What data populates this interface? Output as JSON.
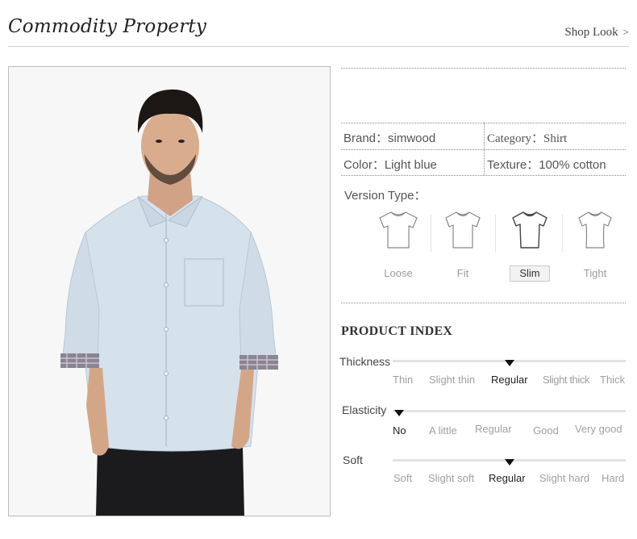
{
  "header": {
    "title": "Commodity Property",
    "shop_look_label": "Shop Look",
    "shop_look_chevron": ">"
  },
  "attributes": {
    "brand": "Brand：simwood",
    "category": "Category：Shirt",
    "color": "Color：Light blue",
    "texture": "Texture：100% cotton"
  },
  "version_type": {
    "label": "Version Type：",
    "options": [
      "Loose",
      "Fit",
      "Slim",
      "Tight"
    ],
    "selected": "Slim"
  },
  "product_index": {
    "title": "PRODUCT INDEX",
    "rows": [
      {
        "label": "Thickness",
        "options": [
          "Thin",
          "Slight thin",
          "Regular",
          "Slight thick",
          "Thick"
        ],
        "selected": "Regular",
        "level": 0.5
      },
      {
        "label": "Elasticity",
        "options": [
          "No",
          "A little",
          "Regular",
          "Good",
          "Very good"
        ],
        "selected": "No",
        "level": 0.0
      },
      {
        "label": "Soft",
        "options": [
          "Soft",
          "Slight soft",
          "Regular",
          "Slight hard",
          "Hard"
        ],
        "selected": "Regular",
        "level": 0.5
      }
    ]
  },
  "colors": {
    "shirt": "#d5e2ec",
    "marker": "#111111",
    "selected_badge": "#f2f2f2"
  }
}
